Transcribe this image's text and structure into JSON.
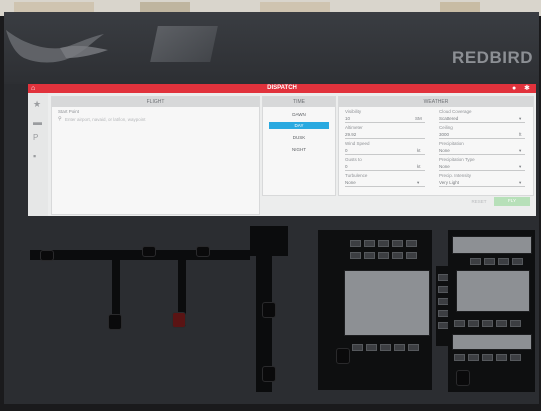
{
  "environment": {
    "brand_text": "REDBIRD"
  },
  "app": {
    "title": "DISPATCH",
    "icons": [
      "home-icon",
      "user-icon",
      "settings-icon"
    ]
  },
  "sidebar": {
    "icons": [
      "star-icon",
      "folder-icon",
      "document-icon",
      "list-icon"
    ]
  },
  "flight_plan": {
    "header": "FLIGHT",
    "start_point_label": "Start Point",
    "search_placeholder": "Enter airport, navaid, or lat/lon, waypoint"
  },
  "time_of_day": {
    "header": "TIME",
    "options": [
      "DAWN",
      "DAY",
      "DUSK",
      "NIGHT"
    ],
    "selected": "DAY"
  },
  "weather": {
    "header": "WEATHER",
    "visibility_label": "Visibility",
    "visibility_value": "10",
    "visibility_unit": "SM",
    "cloud_coverage_label": "Cloud Coverage",
    "cloud_coverage_value": "Scattered",
    "ceiling_label": "Ceiling",
    "ceiling_value": "3000",
    "ceiling_unit": "ft",
    "altimeter_label": "Altimeter",
    "altimeter_value": "29.92",
    "precipitation_label": "Precipitation",
    "precipitation_value": "None",
    "wind_speed_label": "Wind Speed",
    "wind_speed_value": "0",
    "wind_speed_unit": "kt",
    "precip_type_label": "Precipitation Type",
    "precip_type_value": "None",
    "gust_label": "Gusts to",
    "gust_value": "0",
    "gust_unit": "kt",
    "precip_intensity_label": "Precip. Intensity",
    "precip_intensity_value": "Very Light",
    "turbulence_label": "Turbulence",
    "turbulence_value": "None"
  },
  "footer": {
    "reset_label": "RESET",
    "fly_label": "FLY"
  }
}
